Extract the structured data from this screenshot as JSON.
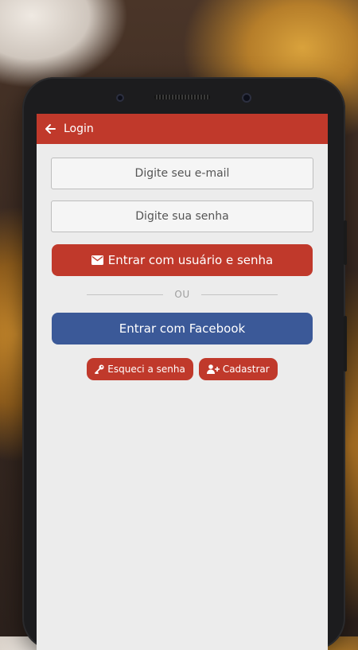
{
  "appbar": {
    "title": "Login",
    "back_icon": "arrow-left-icon"
  },
  "form": {
    "email_placeholder": "Digite seu e-mail",
    "password_placeholder": "Digite sua senha",
    "login_button_label": "Entrar com usuário e senha",
    "login_button_icon": "envelope-icon",
    "divider_text": "OU",
    "facebook_button_label": "Entrar com Facebook"
  },
  "links": {
    "forgot_label": "Esqueci a senha",
    "forgot_icon": "key-icon",
    "register_label": "Cadastrar",
    "register_icon": "user-plus-icon"
  },
  "colors": {
    "primary": "#c0392b",
    "facebook": "#3b5998",
    "screen_bg": "#ececec"
  }
}
